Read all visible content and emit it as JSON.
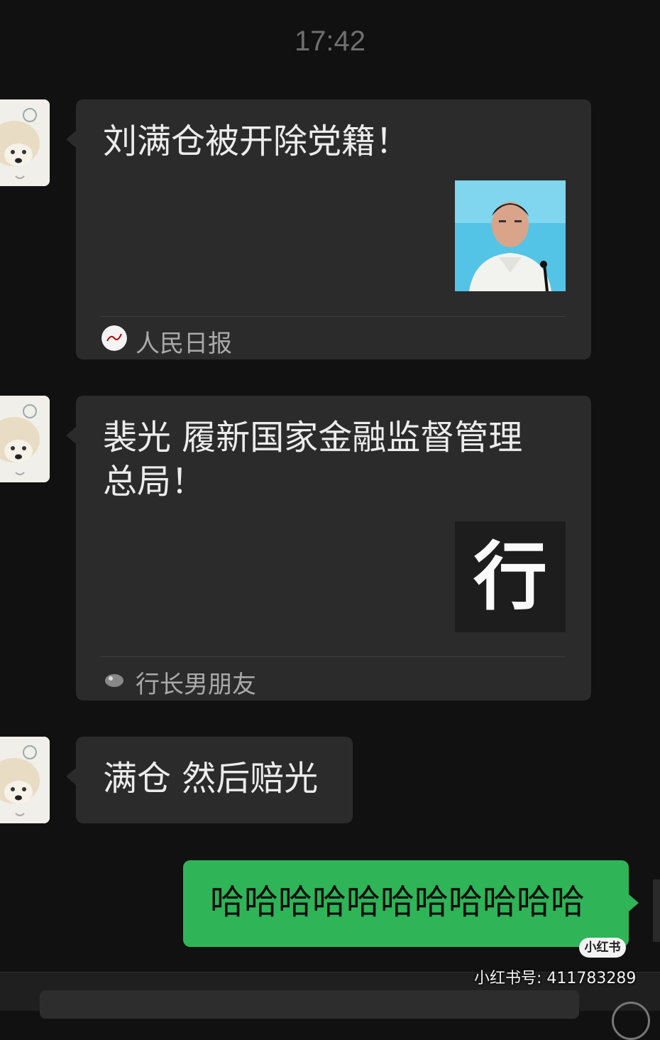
{
  "timestamp": "17:42",
  "messages": [
    {
      "title": "刘满仓被开除党籍！",
      "source": "人民日报",
      "source_logo_text": "人民日报"
    },
    {
      "title_line1": "裴光 履新国家金融监督管理",
      "title_line2": "总局！",
      "thumb_char": "行",
      "source": "行长男朋友"
    },
    {
      "text": "满仓 然后赔光"
    },
    {
      "text": "哈哈哈哈哈哈哈哈哈哈哈"
    }
  ],
  "watermark": {
    "badge": "小红书",
    "id_text": "小红书号: 411783289"
  },
  "colors": {
    "background": "#111111",
    "card": "#2b2b2b",
    "outgoing_bubble": "#2fb457"
  }
}
